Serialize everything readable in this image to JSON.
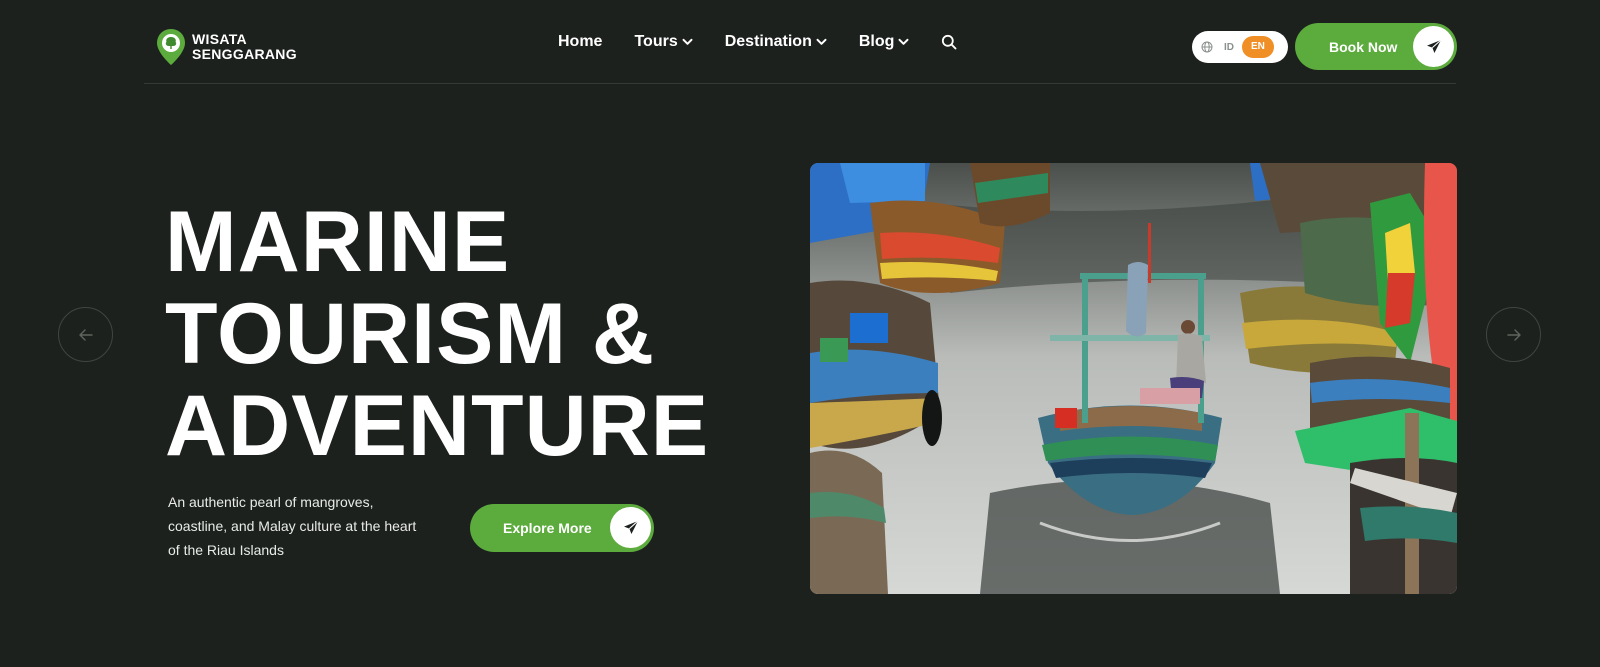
{
  "brand": {
    "line1": "WISATA",
    "line2": "SENGGARANG",
    "accent_color": "#5cab3d",
    "icon": "map-pin-tree-icon"
  },
  "nav": {
    "items": [
      {
        "label": "Home",
        "has_dropdown": false
      },
      {
        "label": "Tours",
        "has_dropdown": true
      },
      {
        "label": "Destination",
        "has_dropdown": true
      },
      {
        "label": "Blog",
        "has_dropdown": true
      }
    ],
    "search_icon": "search-icon"
  },
  "language": {
    "globe_icon": "globe-icon",
    "options": [
      "ID",
      "EN"
    ],
    "selected": "EN",
    "selected_color": "#ef8f25"
  },
  "header_cta": {
    "label": "Book Now",
    "icon": "paper-plane-icon"
  },
  "hero": {
    "title_lines": [
      "MARINE",
      "TOURISM &",
      "ADVENTURE"
    ],
    "description": "An authentic pearl of mangroves, coastline, and Malay culture at the heart of the Riau Islands",
    "cta_label": "Explore More",
    "cta_icon": "paper-plane-icon",
    "prev_icon": "arrow-left-icon",
    "next_icon": "arrow-right-icon",
    "image_subject": "fishing-boats-canal-photo"
  },
  "colors": {
    "background": "#1d211e",
    "button_green": "#5cab3d",
    "text": "#ffffff"
  }
}
